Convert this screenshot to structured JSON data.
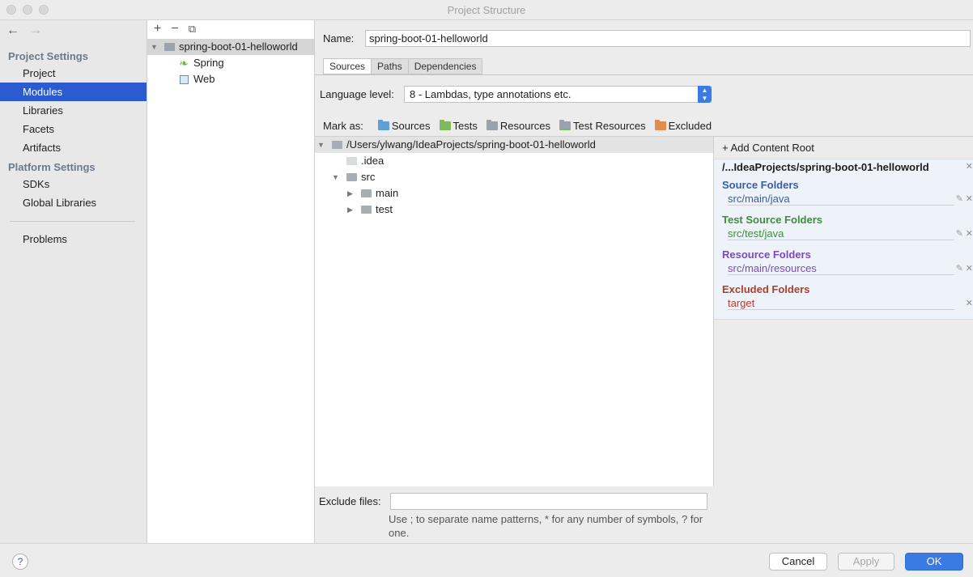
{
  "window": {
    "title": "Project Structure"
  },
  "nav": {
    "back_icon": "←",
    "forward_icon": "→",
    "project_settings_label": "Project Settings",
    "platform_settings_label": "Platform Settings",
    "items": {
      "project": "Project",
      "modules": "Modules",
      "libraries": "Libraries",
      "facets": "Facets",
      "artifacts": "Artifacts",
      "sdks": "SDKs",
      "global_libraries": "Global Libraries",
      "problems": "Problems"
    }
  },
  "modules_panel": {
    "add_icon": "+",
    "remove_icon": "−",
    "copy_icon": "⧉",
    "module_name": "spring-boot-01-helloworld",
    "facets": [
      "Spring",
      "Web"
    ]
  },
  "module": {
    "name_label": "Name:",
    "name_value": "spring-boot-01-helloworld",
    "tabs": [
      "Sources",
      "Paths",
      "Dependencies"
    ],
    "language_level_label": "Language level:",
    "language_level_value": "8 - Lambdas, type annotations etc.",
    "mark_as_label": "Mark as:",
    "mark_as": [
      {
        "label": "Sources",
        "color": "#5f9fd6"
      },
      {
        "label": "Tests",
        "color": "#7fba5b"
      },
      {
        "label": "Resources",
        "color": "#9aa3ad"
      },
      {
        "label": "Test Resources",
        "color": "#9aa3ad"
      },
      {
        "label": "Excluded",
        "color": "#e08e4d"
      }
    ]
  },
  "tree": {
    "root": "/Users/ylwang/IdeaProjects/spring-boot-01-helloworld",
    "idea": ".idea",
    "src": "src",
    "main": "main",
    "test": "test"
  },
  "exclude": {
    "label": "Exclude files:",
    "hint": "Use ; to separate name patterns, * for any number of symbols, ? for one."
  },
  "roots": {
    "add_content_root": "+ Add Content Root",
    "root_path": "/...IdeaProjects/spring-boot-01-helloworld",
    "groups": [
      {
        "title": "Source Folders",
        "path": "src/main/java",
        "color": "#3a5f9e"
      },
      {
        "title": "Test Source Folders",
        "path": "src/test/java",
        "color": "#3f8b3f"
      },
      {
        "title": "Resource Folders",
        "path": "src/main/resources",
        "color": "#7a4bbb"
      },
      {
        "title": "Excluded Folders",
        "path": "target",
        "color": "#c0392b"
      }
    ]
  },
  "buttons": {
    "help": "?",
    "cancel": "Cancel",
    "apply": "Apply",
    "ok": "OK"
  }
}
